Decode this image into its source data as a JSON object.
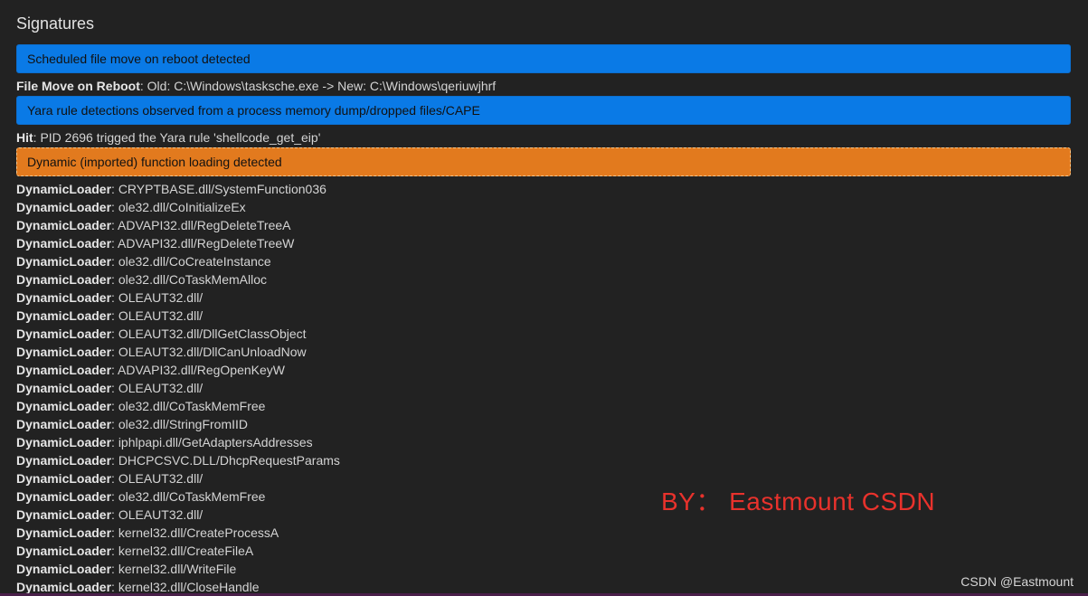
{
  "section_title": "Signatures",
  "signatures": [
    {
      "title": "Scheduled file move on reboot detected",
      "color": "#0a7ae6",
      "detail_key": "File Move on Reboot",
      "detail_value": ": Old: C:\\Windows\\tasksche.exe -> New: C:\\Windows\\qeriuwjhrf"
    },
    {
      "title": "Yara rule detections observed from a process memory dump/dropped files/CAPE",
      "color": "#0a7ae6",
      "detail_key": "Hit",
      "detail_value": ": PID 2696 trigged the Yara rule 'shellcode_get_eip'"
    },
    {
      "title": "Dynamic (imported) function loading detected",
      "color": "#e27a1e"
    }
  ],
  "loader_key": "DynamicLoader",
  "loader_items": [
    ": CRYPTBASE.dll/SystemFunction036",
    ": ole32.dll/CoInitializeEx",
    ": ADVAPI32.dll/RegDeleteTreeA",
    ": ADVAPI32.dll/RegDeleteTreeW",
    ": ole32.dll/CoCreateInstance",
    ": ole32.dll/CoTaskMemAlloc",
    ": OLEAUT32.dll/",
    ": OLEAUT32.dll/",
    ": OLEAUT32.dll/DllGetClassObject",
    ": OLEAUT32.dll/DllCanUnloadNow",
    ": ADVAPI32.dll/RegOpenKeyW",
    ": OLEAUT32.dll/",
    ": ole32.dll/CoTaskMemFree",
    ": ole32.dll/StringFromIID",
    ": iphlpapi.dll/GetAdaptersAddresses",
    ": DHCPCSVC.DLL/DhcpRequestParams",
    ": OLEAUT32.dll/",
    ": ole32.dll/CoTaskMemFree",
    ": OLEAUT32.dll/",
    ": kernel32.dll/CreateProcessA",
    ": kernel32.dll/CreateFileA",
    ": kernel32.dll/WriteFile",
    ": kernel32.dll/CloseHandle"
  ],
  "watermark": "BY： Eastmount CSDN",
  "csdn_mark": "CSDN @Eastmount"
}
